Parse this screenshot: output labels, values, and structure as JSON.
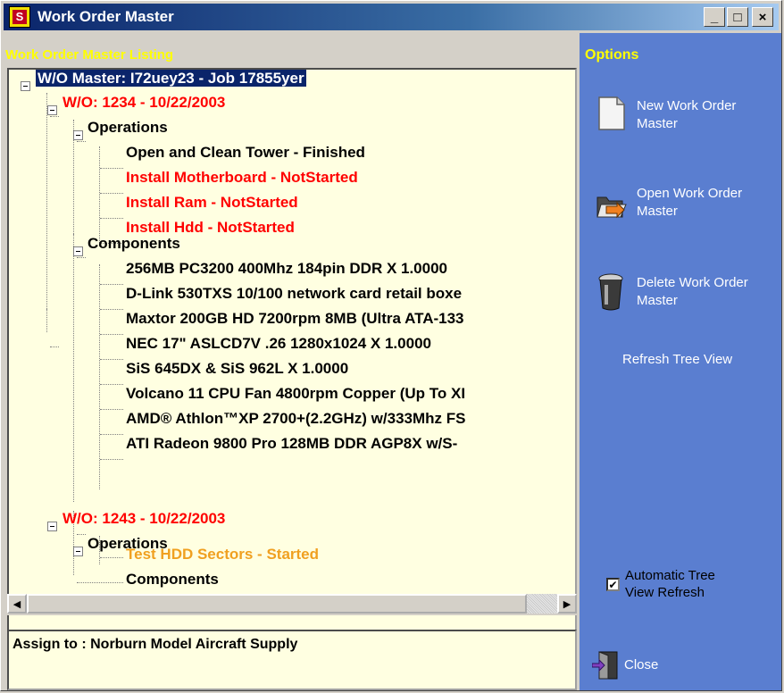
{
  "window": {
    "title": "Work Order Master",
    "icon_letter": "S",
    "buttons": [
      "_",
      "□",
      "×"
    ]
  },
  "left": {
    "listing_label": "Work Order Master Listing",
    "tree": [
      {
        "text": "W/O Master: I72uey23 - Job 17855yer",
        "color": "selected",
        "expander": true
      },
      {
        "text": "W/O: 1234 - 10/22/2003",
        "color": "red",
        "expander": true
      },
      {
        "text": "Operations",
        "color": "black",
        "expander": true
      },
      {
        "text": "Open and Clean Tower - Finished",
        "color": "black",
        "expander": false
      },
      {
        "text": "Install Motherboard - NotStarted",
        "color": "red",
        "expander": false
      },
      {
        "text": "Install Ram - NotStarted",
        "color": "red",
        "expander": false
      },
      {
        "text": "Install Hdd - NotStarted",
        "color": "red",
        "expander": false
      },
      {
        "text": "Components",
        "color": "black",
        "expander": true
      },
      {
        "text": "256MB PC3200 400Mhz 184pin DDR X 1.0000",
        "color": "black",
        "expander": false
      },
      {
        "text": "D-Link 530TXS 10/100 network card retail boxe",
        "color": "black",
        "expander": false
      },
      {
        "text": "Maxtor 200GB HD 7200rpm 8MB (Ultra ATA-133",
        "color": "black",
        "expander": false
      },
      {
        "text": "NEC 17\" ASLCD7V .26 1280x1024 X 1.0000",
        "color": "black",
        "expander": false
      },
      {
        "text": "SiS 645DX & SiS 962L X 1.0000",
        "color": "black",
        "expander": false
      },
      {
        "text": "Volcano 11 CPU Fan 4800rpm Copper (Up To XI",
        "color": "black",
        "expander": false
      },
      {
        "text": "AMD® Athlon™XP 2700+(2.2GHz) w/333Mhz FS",
        "color": "black",
        "expander": false
      },
      {
        "text": "ATI Radeon 9800 Pro 128MB DDR AGP8X w/S-",
        "color": "black",
        "expander": false
      },
      {
        "text": "W/O: 1243 - 10/22/2003",
        "color": "red",
        "expander": true
      },
      {
        "text": "Operations",
        "color": "black",
        "expander": true
      },
      {
        "text": "Test HDD Sectors - Started",
        "color": "orange",
        "expander": false
      },
      {
        "text": "Components",
        "color": "black",
        "expander": false
      }
    ],
    "assign_text": "Assign to : Norburn Model Aircraft Supply"
  },
  "options": {
    "label": "Options",
    "new_line1": "New Work Order",
    "new_line2": "Master",
    "open_line1": "Open Work Order",
    "open_line2": "Master",
    "delete_line1": "Delete Work Order",
    "delete_line2": "Master",
    "refresh": "Refresh Tree View",
    "auto_refresh_line1": "Automatic Tree",
    "auto_refresh_line2": "View Refresh",
    "auto_refresh_checked": true,
    "close": "Close"
  }
}
